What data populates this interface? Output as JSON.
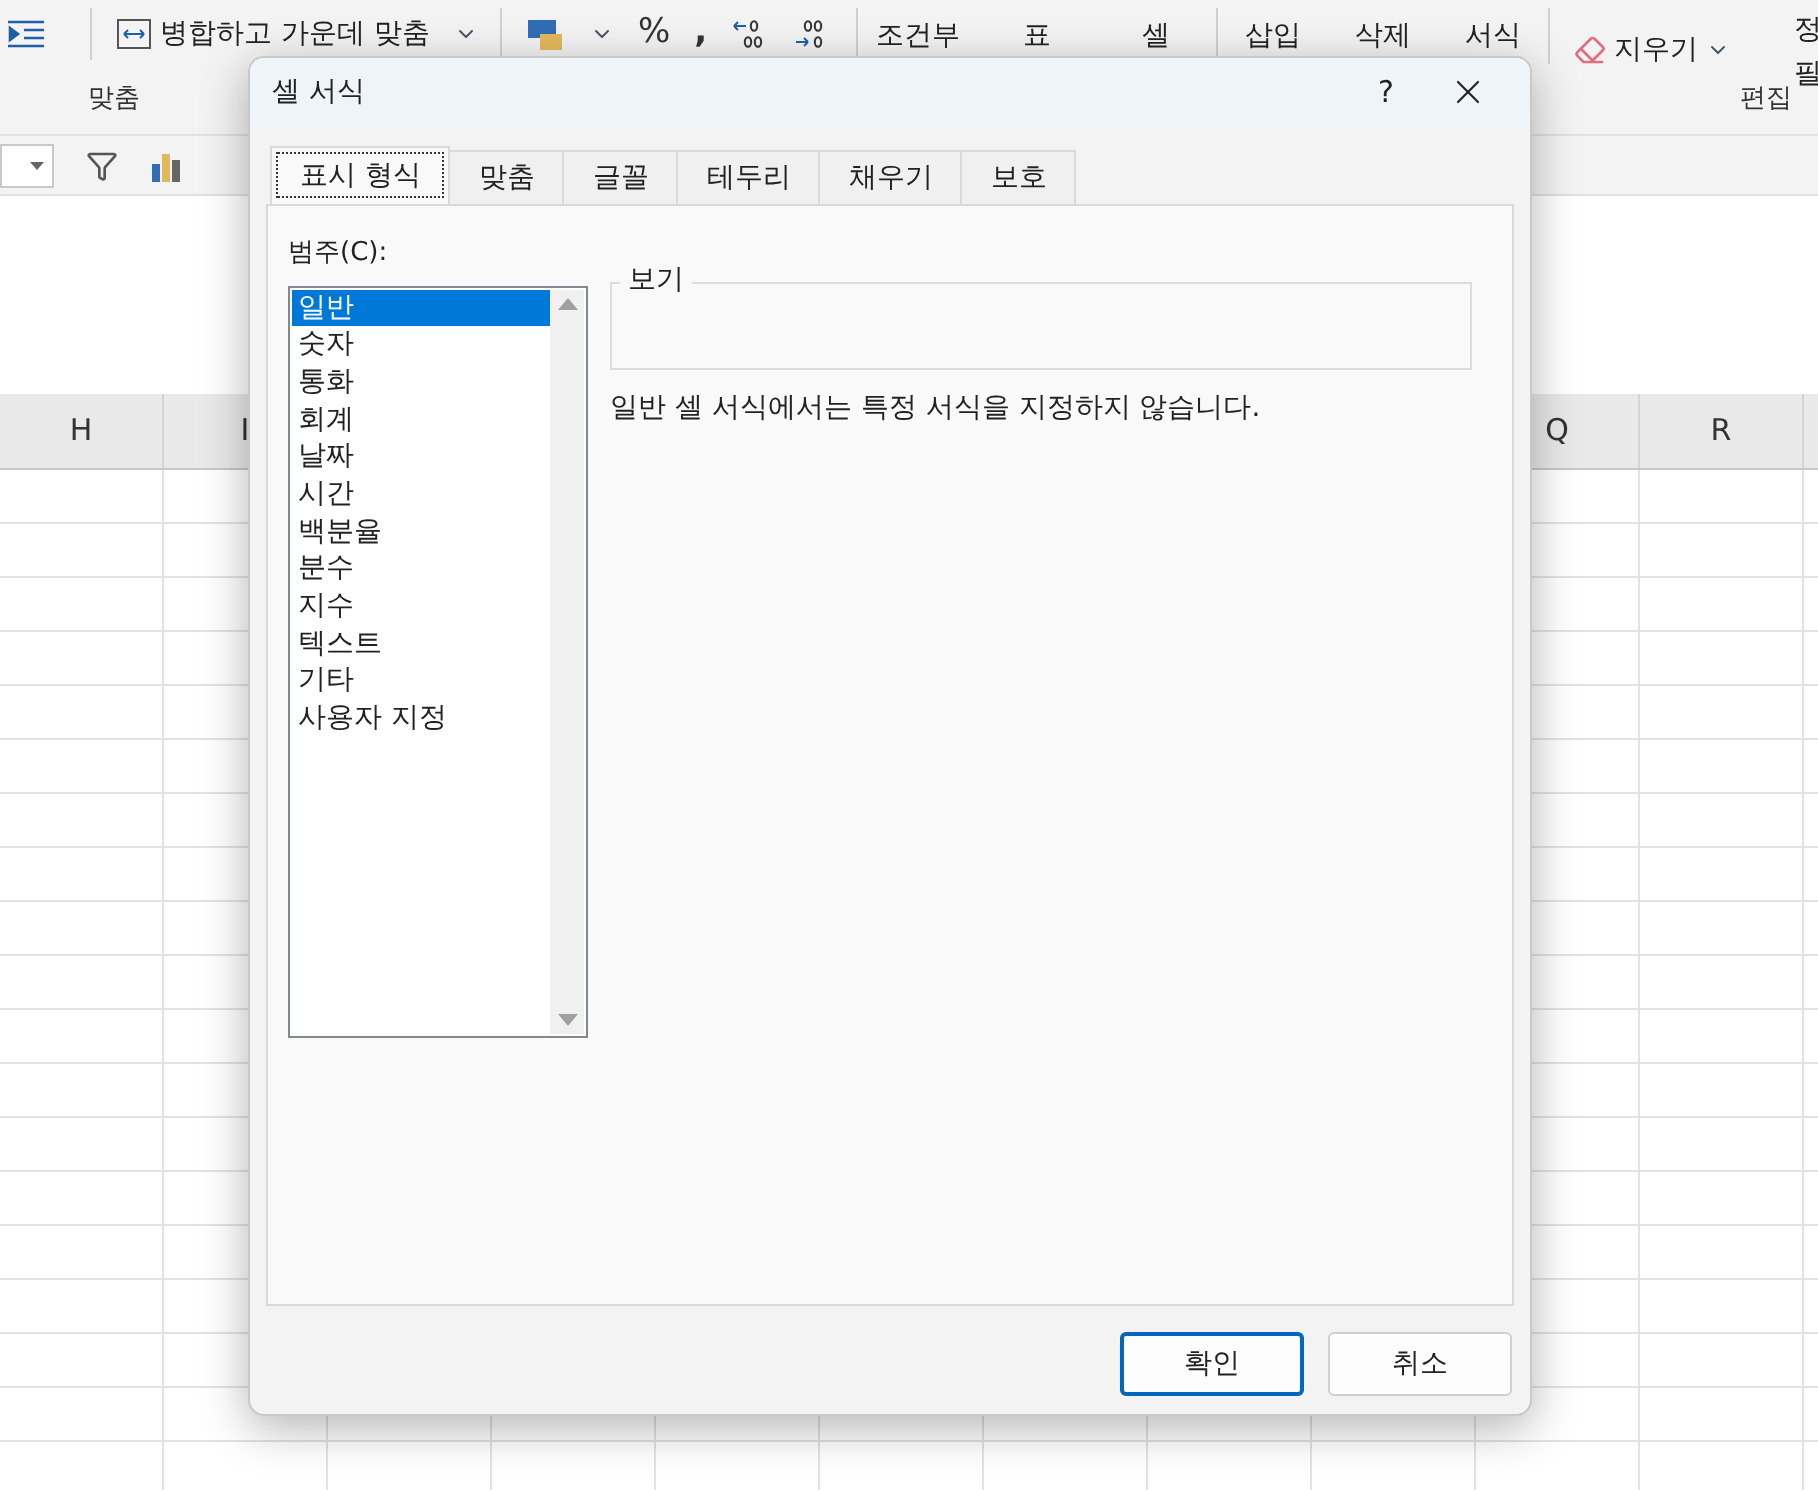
{
  "ribbon": {
    "merge_button": "병합하고 가운데 맞춤",
    "percent": "%",
    "comma": ",",
    "commands": [
      {
        "label": "조건부"
      },
      {
        "label": "표"
      },
      {
        "label": "셀"
      },
      {
        "label": "삽입"
      },
      {
        "label": "삭제"
      },
      {
        "label": "서식"
      }
    ],
    "clear_button": "지우기",
    "cut_labels": [
      "정",
      "필"
    ],
    "groups": [
      "맞춤",
      "편집"
    ]
  },
  "sheet": {
    "columns": [
      {
        "label": "H"
      },
      {
        "label": "I"
      },
      {
        "label": "Q"
      },
      {
        "label": "R"
      }
    ]
  },
  "dialog": {
    "title": "셀 서식",
    "help": "?",
    "tabs": [
      {
        "label": "표시 형식",
        "selected": true
      },
      {
        "label": "맞춤",
        "selected": false
      },
      {
        "label": "글꼴",
        "selected": false
      },
      {
        "label": "테두리",
        "selected": false
      },
      {
        "label": "채우기",
        "selected": false
      },
      {
        "label": "보호",
        "selected": false
      }
    ],
    "category_label": "범주(C):",
    "categories": [
      {
        "label": "일반",
        "selected": true
      },
      {
        "label": "숫자",
        "selected": false
      },
      {
        "label": "통화",
        "selected": false
      },
      {
        "label": "회계",
        "selected": false
      },
      {
        "label": "날짜",
        "selected": false
      },
      {
        "label": "시간",
        "selected": false
      },
      {
        "label": "백분율",
        "selected": false
      },
      {
        "label": "분수",
        "selected": false
      },
      {
        "label": "지수",
        "selected": false
      },
      {
        "label": "텍스트",
        "selected": false
      },
      {
        "label": "기타",
        "selected": false
      },
      {
        "label": "사용자 지정",
        "selected": false
      }
    ],
    "preview_label": "보기",
    "description": "일반 셀 서식에서는 특정 서식을 지정하지 않습니다.",
    "buttons": [
      {
        "label": "확인",
        "default": true
      },
      {
        "label": "취소",
        "default": false
      }
    ]
  }
}
